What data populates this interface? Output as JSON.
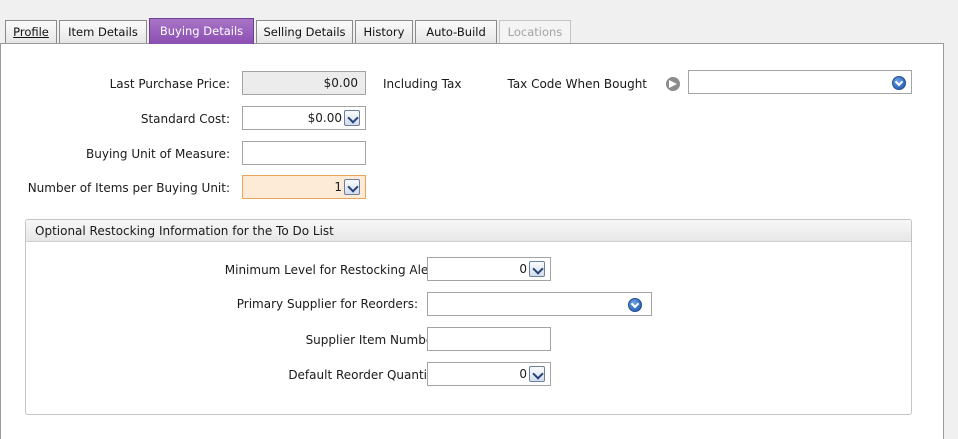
{
  "tabs": {
    "profile": "Profile",
    "item_details": "Item Details",
    "buying_details": "Buying Details",
    "selling_details": "Selling Details",
    "history": "History",
    "auto_build": "Auto-Build",
    "locations": "Locations"
  },
  "fields": {
    "last_purchase_price": {
      "label": "Last Purchase Price:",
      "value": "$0.00"
    },
    "including_tax": "Including Tax",
    "tax_code_when_bought": {
      "label": "Tax Code When Bought",
      "value": ""
    },
    "standard_cost": {
      "label": "Standard Cost:",
      "value": "$0.00"
    },
    "buying_unit_of_measure": {
      "label": "Buying Unit of Measure:",
      "value": ""
    },
    "items_per_buying_unit": {
      "label": "Number of Items per Buying Unit:",
      "value": "1"
    }
  },
  "restocking": {
    "title": "Optional Restocking Information for the To Do List",
    "minimum_level": {
      "label": "Minimum Level for Restocking Alert:",
      "value": "0"
    },
    "primary_supplier": {
      "label": "Primary Supplier for Reorders:",
      "value": ""
    },
    "supplier_item_number": {
      "label": "Supplier Item Number:",
      "value": ""
    },
    "default_reorder_quantity": {
      "label": "Default Reorder Quantity:",
      "value": "0"
    }
  },
  "icons": {
    "dropdown": "chevron-down-icon",
    "combo": "circle-chevron-down-icon",
    "link_arrow": "arrow-right-circle-icon"
  },
  "colors": {
    "active_tab": "#9a5fbd",
    "highlight_field": "#fdebd7",
    "readonly_field": "#ececec",
    "accent_icon": "#2f66b9"
  }
}
